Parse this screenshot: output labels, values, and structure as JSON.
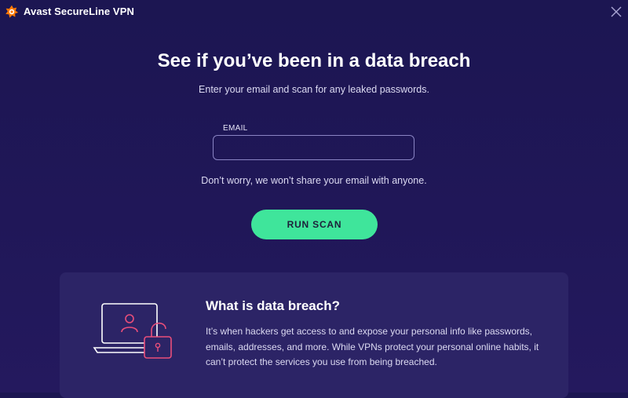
{
  "window": {
    "title": "Avast SecureLine VPN",
    "brand_color": "#ff7800",
    "logo_icon": "avast-logo-icon",
    "close_icon": "close-icon"
  },
  "main": {
    "headline": "See if you’ve been in a data breach",
    "subheadline": "Enter your email and scan for any leaked passwords.",
    "email": {
      "label": "EMAIL",
      "value": "",
      "placeholder": ""
    },
    "privacy_note": "Don’t worry, we won’t share your email with anyone.",
    "run_scan_label": "RUN SCAN",
    "accent_color": "#3fe59b"
  },
  "info_card": {
    "illustration_icon": "laptop-lock-icon",
    "title": "What is data breach?",
    "body": "It’s when hackers get access to and expose your personal info like passwords, emails, addresses, and more. While VPNs protect your personal online habits, it can’t protect the services you use from being breached."
  }
}
